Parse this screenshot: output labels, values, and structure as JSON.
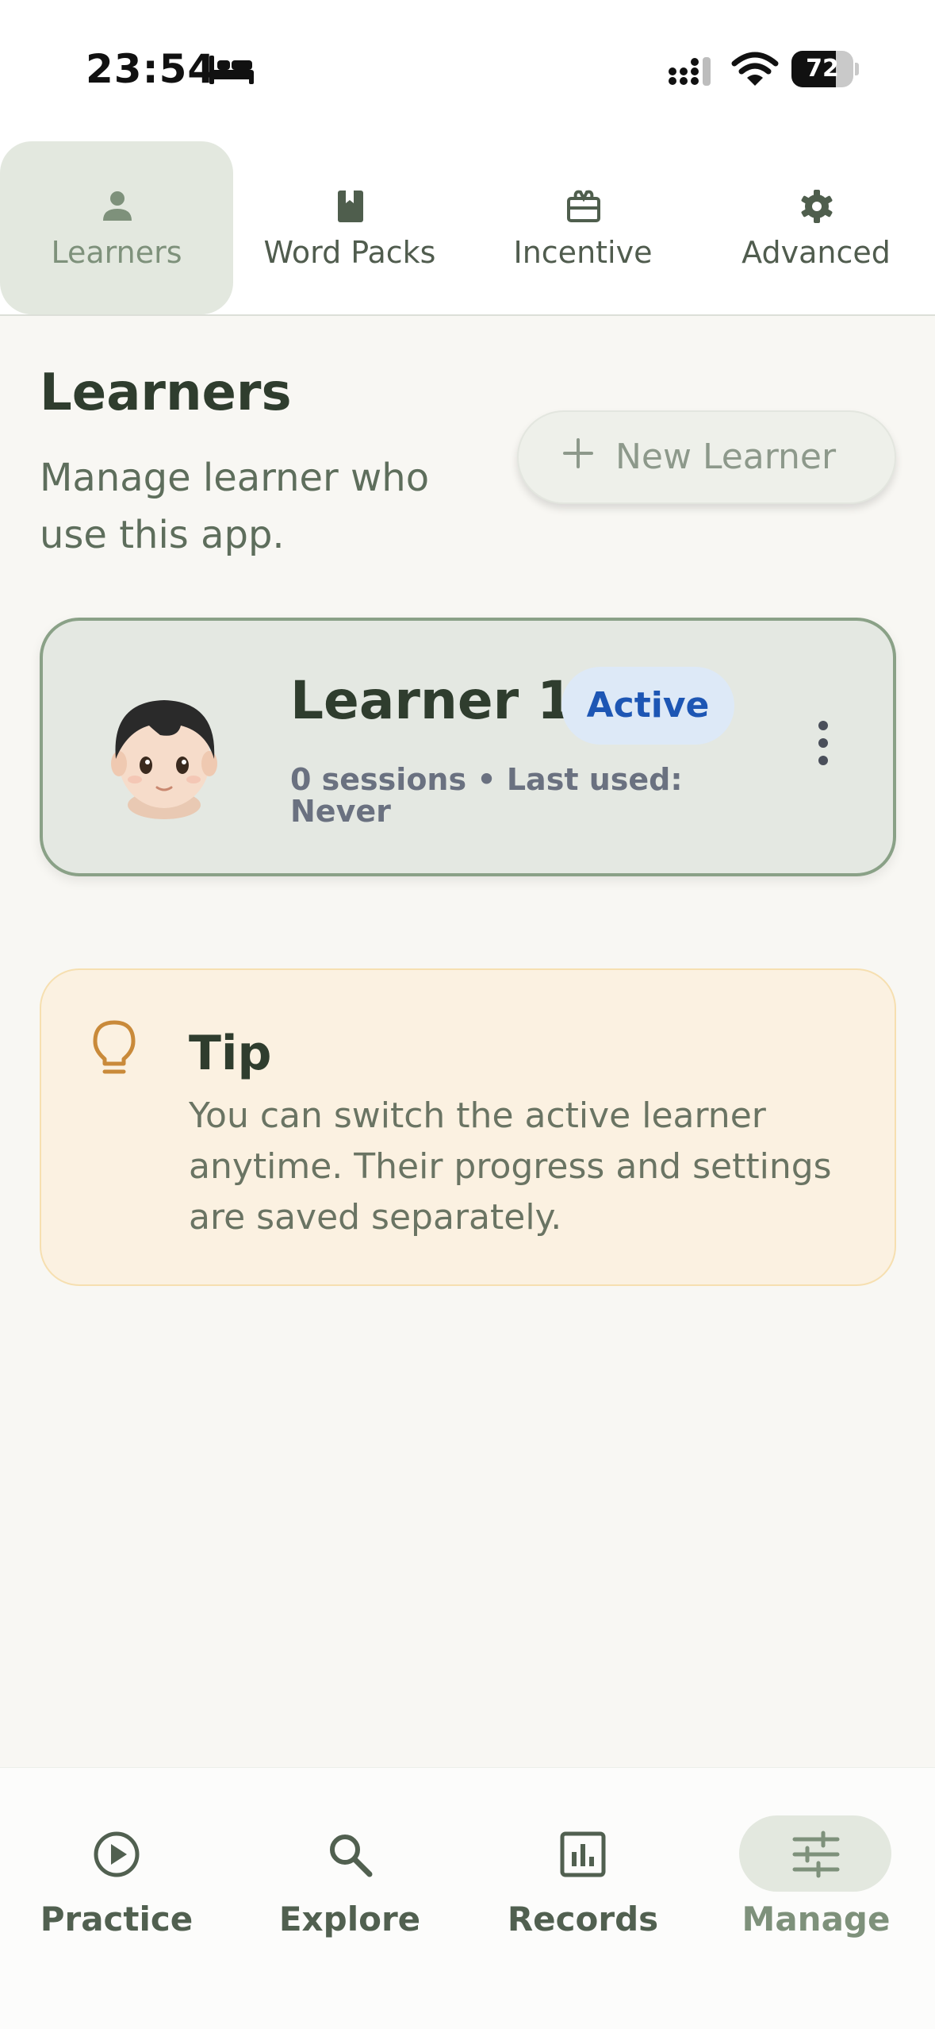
{
  "status_bar": {
    "time": "23:54",
    "battery": "72",
    "battery_level": 0.72,
    "icons": [
      "bed-icon",
      "signal-icon",
      "wifi-icon",
      "battery-icon"
    ]
  },
  "tabs": [
    {
      "label": "Learners",
      "icon": "person-icon",
      "active": true
    },
    {
      "label": "Word Packs",
      "icon": "book-icon",
      "active": false
    },
    {
      "label": "Incentive",
      "icon": "gift-icon",
      "active": false
    },
    {
      "label": "Advanced",
      "icon": "gear-icon",
      "active": false
    }
  ],
  "header": {
    "title": "Learners",
    "subtitle": "Manage learner who use this app.",
    "new_button_label": "New Learner"
  },
  "learners": [
    {
      "name": "Learner 1",
      "status": "Active",
      "meta": "0 sessions  •  Last used: Never",
      "avatar": "child-emoji"
    }
  ],
  "tip": {
    "title": "Tip",
    "text": "You can switch the active learner anytime. Their progress and settings are saved separately."
  },
  "bottom_nav": [
    {
      "label": "Practice",
      "icon": "play-circle-icon",
      "active": false
    },
    {
      "label": "Explore",
      "icon": "search-icon",
      "active": false
    },
    {
      "label": "Records",
      "icon": "bar-chart-icon",
      "active": false
    },
    {
      "label": "Manage",
      "icon": "sliders-icon",
      "active": true
    }
  ],
  "colors": {
    "accent_green": "#7e917b",
    "active_badge_bg": "#dde9f7",
    "active_badge_text": "#1d56b4",
    "tip_bg": "#fbf1e1",
    "tip_icon": "#c98a3a"
  }
}
